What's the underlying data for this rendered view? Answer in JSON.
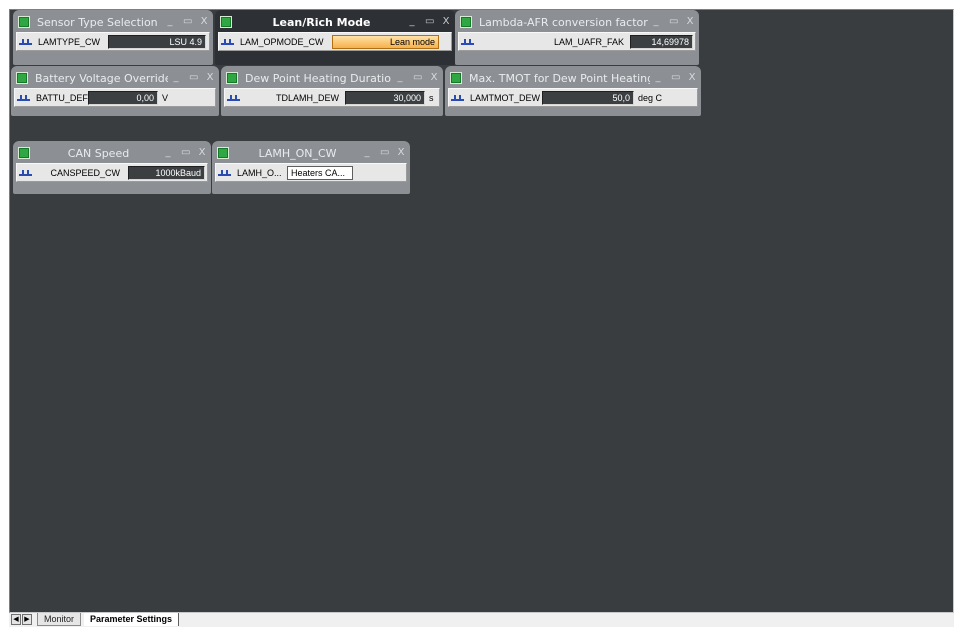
{
  "tabs": {
    "monitor": "Monitor",
    "parameter_settings": "Parameter Settings"
  },
  "window_controls": {
    "minimize": "_",
    "maximize": "▭",
    "close": "X"
  },
  "panels": {
    "sensor_type": {
      "title": "Sensor Type Selection",
      "param": "LAMTYPE_CW",
      "value": "LSU 4.9"
    },
    "lean_rich": {
      "title": "Lean/Rich Mode",
      "param": "LAM_OPMODE_CW",
      "value": "Lean mode"
    },
    "lambda_afr": {
      "title": "Lambda-AFR conversion factor",
      "param": "LAM_UAFR_FAK",
      "value": "14,69978"
    },
    "battery": {
      "title": "Battery Voltage Override",
      "param": "BATTU_DEF",
      "value": "0,00",
      "unit": "V"
    },
    "dew_point": {
      "title": "Dew Point Heating Duration",
      "param": "TDLAMH_DEW",
      "value": "30,000",
      "unit": "s"
    },
    "tmot": {
      "title": "Max. TMOT for Dew Point Heating",
      "param": "LAMTMOT_DEW",
      "value": "50,0",
      "unit": "deg C"
    },
    "can_speed": {
      "title": "CAN Speed",
      "param": "CANSPEED_CW",
      "value": "1000kBaud"
    },
    "lamh_on": {
      "title": "LAMH_ON_CW",
      "param": "LAMH_O...",
      "value": "Heaters CA..."
    }
  },
  "colors": {
    "workspace": "#3a3d40",
    "panel": "#8c9095",
    "active_panel": "#2d3034",
    "highlight_value": "#f6b14b"
  }
}
